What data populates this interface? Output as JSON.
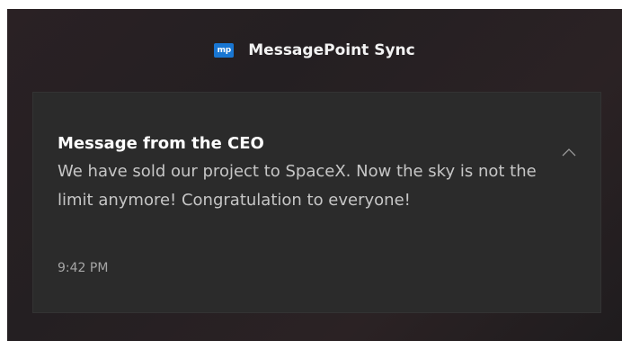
{
  "app": {
    "icon_text": "mp",
    "name": "MessagePoint Sync",
    "icon_color": "#1976d2"
  },
  "notification": {
    "title": "Message from the CEO",
    "body": "We have sold our project to SpaceX. Now the sky is not the limit anymore! Congratulation to everyone!",
    "time": "9:42 PM",
    "collapse_icon": "chevron-up-icon"
  },
  "colors": {
    "toast_background": "#2b2b2b",
    "panel_background": "#241f22",
    "title_text": "#ffffff",
    "body_text": "#c6c6c6"
  }
}
